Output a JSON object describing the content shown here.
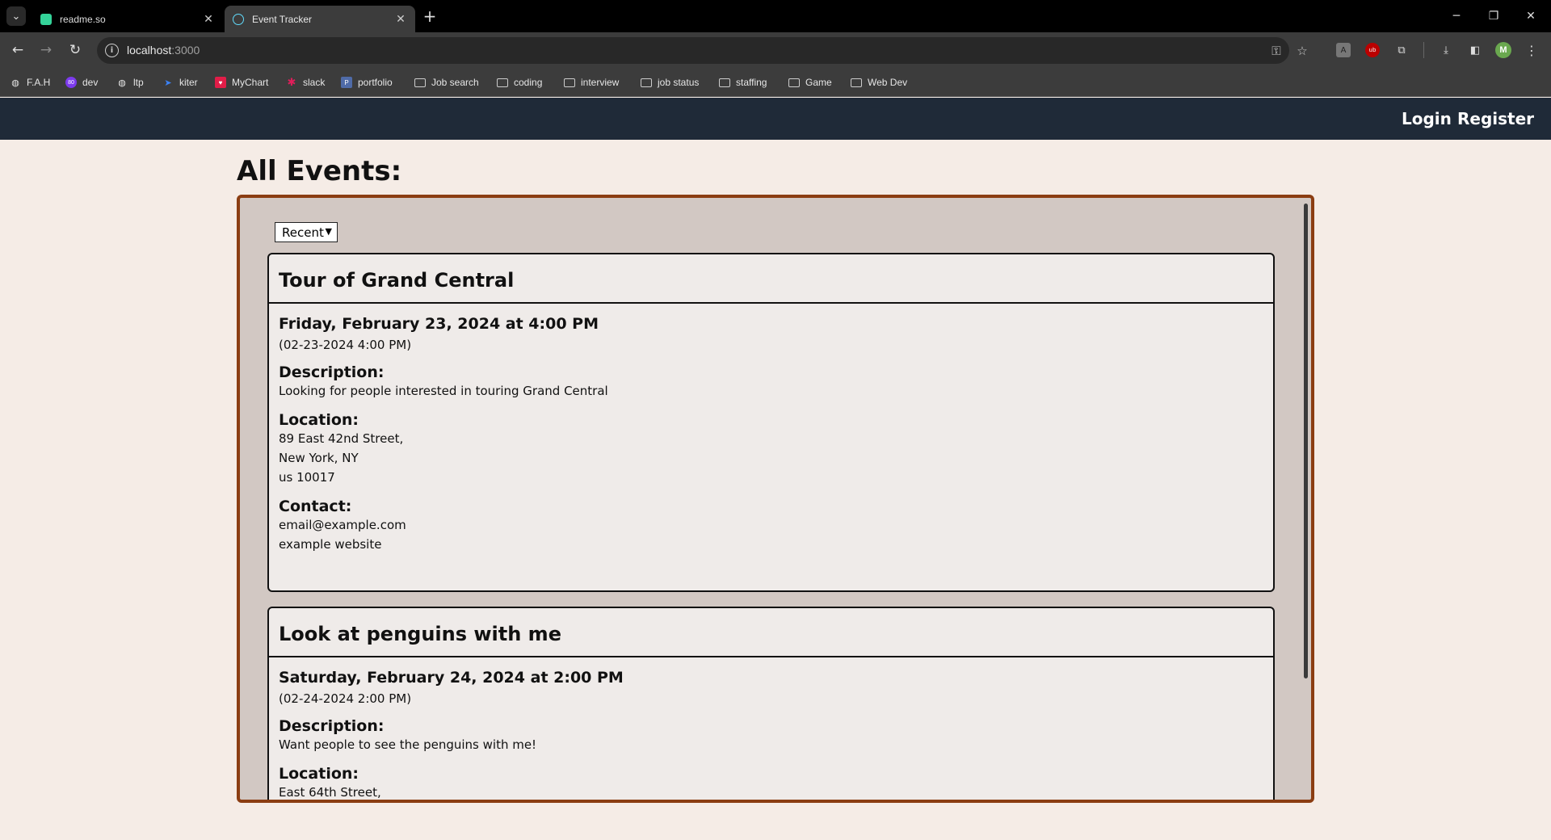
{
  "browser": {
    "tabs": [
      {
        "title": "readme.so",
        "active": false,
        "favicon_color": "#34d399"
      },
      {
        "title": "Event Tracker",
        "active": true,
        "favicon_color": "#61dafb"
      }
    ],
    "url": "localhost",
    "url_port": ":3000",
    "bookmarks": [
      {
        "label": "F.A.H",
        "icon": "globe-icon"
      },
      {
        "label": "dev",
        "icon": "dev-icon"
      },
      {
        "label": "ltp",
        "icon": "globe-icon"
      },
      {
        "label": "kiter",
        "icon": "kiter-icon"
      },
      {
        "label": "MyChart",
        "icon": "mychart-icon"
      },
      {
        "label": "slack",
        "icon": "slack-icon"
      },
      {
        "label": "portfolio",
        "icon": "portfolio-icon"
      },
      {
        "label": "Job search",
        "icon": "folder-icon"
      },
      {
        "label": "coding",
        "icon": "folder-icon"
      },
      {
        "label": "interview",
        "icon": "folder-icon"
      },
      {
        "label": "job status",
        "icon": "folder-icon"
      },
      {
        "label": "staffing",
        "icon": "folder-icon"
      },
      {
        "label": "Game",
        "icon": "folder-icon"
      },
      {
        "label": "Web Dev",
        "icon": "folder-icon"
      }
    ],
    "avatar_letter": "M"
  },
  "nav": {
    "login": "Login",
    "register": "Register"
  },
  "page": {
    "title": "All Events:",
    "sort": {
      "selected": "Recent"
    }
  },
  "events": [
    {
      "title": "Tour of Grand Central",
      "when": "Friday, February 23, 2024 at 4:00 PM",
      "when_short": "(02-23-2024 4:00 PM)",
      "description_label": "Description:",
      "description": "Looking for people interested in touring Grand Central",
      "location_label": "Location:",
      "location_lines": [
        "89 East 42nd Street,",
        "New York, NY",
        "us 10017"
      ],
      "contact_label": "Contact:",
      "contact_email": "email@example.com",
      "contact_website": "example website"
    },
    {
      "title": "Look at penguins with me",
      "when": "Saturday, February 24, 2024 at 2:00 PM",
      "when_short": "(02-24-2024 2:00 PM)",
      "description_label": "Description:",
      "description": "Want people to see the penguins with me!",
      "location_label": "Location:",
      "location_lines": [
        "East 64th Street,"
      ]
    }
  ],
  "colors": {
    "page_bg": "#f5ece6",
    "nav_bg": "#1f2a38",
    "frame_border": "#8b3d12",
    "frame_bg": "#d2c8c3",
    "card_bg": "#efebe9"
  }
}
